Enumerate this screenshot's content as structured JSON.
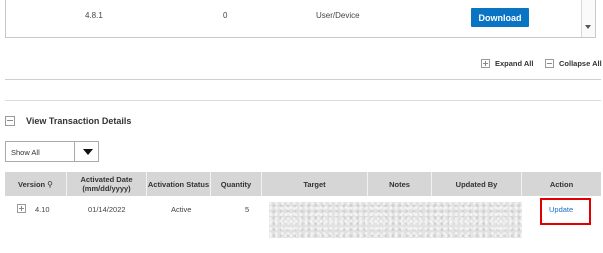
{
  "top_row": {
    "version": "4.8.1",
    "count": "0",
    "type": "User/Device",
    "download_label": "Download"
  },
  "controls": {
    "expand_all": "Expand All",
    "collapse_all": "Collapse All"
  },
  "section": {
    "title": "View Transaction Details"
  },
  "filter": {
    "selected": "Show All"
  },
  "table": {
    "headers": {
      "version": "Version",
      "activated_date": "Activated Date (mm/dd/yyyy)",
      "activation_status": "Activation Status",
      "quantity": "Quantity",
      "target": "Target",
      "notes": "Notes",
      "updated_by": "Updated By",
      "action": "Action"
    },
    "rows": [
      {
        "version": "4.10",
        "activated_date": "01/14/2022",
        "status": "Active",
        "quantity": "5",
        "action": "Update"
      }
    ]
  },
  "colors": {
    "accent": "#0a74c4",
    "highlight": "#e00000",
    "link": "#1a6fc4",
    "header_bg": "#d6d6d6"
  }
}
